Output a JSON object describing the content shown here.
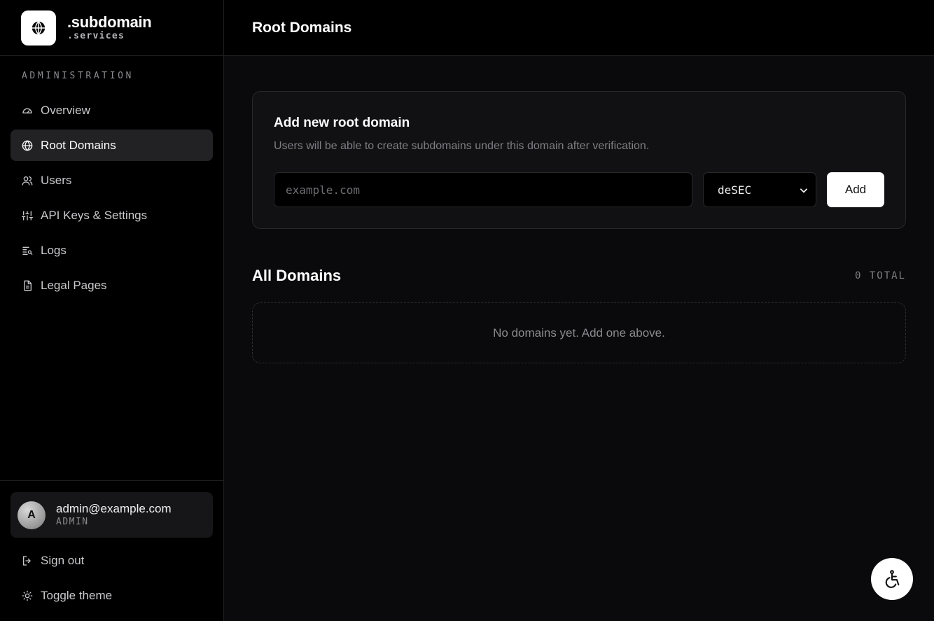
{
  "brand": {
    "title": ".subdomain",
    "subtitle": ".services"
  },
  "sidebar": {
    "section_label": "ADMINISTRATION",
    "items": [
      {
        "label": "Overview",
        "icon": "gauge-icon",
        "active": false
      },
      {
        "label": "Root Domains",
        "icon": "globe-icon",
        "active": true
      },
      {
        "label": "Users",
        "icon": "users-icon",
        "active": false
      },
      {
        "label": "API Keys & Settings",
        "icon": "sliders-icon",
        "active": false
      },
      {
        "label": "Logs",
        "icon": "log-search-icon",
        "active": false
      },
      {
        "label": "Legal Pages",
        "icon": "document-icon",
        "active": false
      }
    ]
  },
  "user": {
    "initial": "A",
    "email": "admin@example.com",
    "role": "ADMIN"
  },
  "footer": {
    "sign_out": "Sign out",
    "toggle_theme": "Toggle theme"
  },
  "header": {
    "title": "Root Domains"
  },
  "add_card": {
    "title": "Add new root domain",
    "description": "Users will be able to create subdomains under this domain after verification.",
    "input_placeholder": "example.com",
    "provider_selected": "deSEC",
    "add_label": "Add"
  },
  "domains": {
    "title": "All Domains",
    "total": "0 TOTAL",
    "empty_message": "No domains yet. Add one above."
  }
}
